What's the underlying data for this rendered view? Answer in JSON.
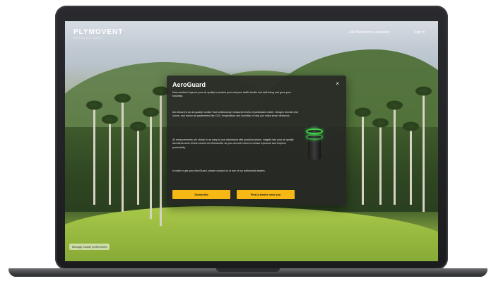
{
  "header": {
    "logo_text": "PLYMOVENT",
    "logo_tagline": "BREATHE EASY",
    "nav": {
      "contact_label": "Ask Plymovent a question",
      "signin_label": "Sign in"
    }
  },
  "modal": {
    "title": "AeroGuard",
    "close_label": "×",
    "paragraphs": [
      "New solution! Improve your air quality to protect your and your staff's health and well-being and grow your business.",
      "AeroGuard is an air-quality monitor that continuously measures levels of particulate matter, nitrogen dioxide and ozone, and indoor-air parameters like CO2, temperature and humidity, to help you make smart decisions.",
      "All measurements are shown in an easy-to-use dashboard with practical advice, insights into your air quality and alerts when levels exceed set thresholds, so you can act in time to reduce exposure and improve productivity.",
      "In order to get your AeroGuard, please contact us or one of our authorized dealers."
    ],
    "buttons": {
      "subscribe_label": "Subscribe",
      "dealer_label": "Find a dealer near you"
    }
  },
  "footer": {
    "preferences_label": "Manage cookie preferences"
  },
  "colors": {
    "accent": "#f5b814",
    "device_ring": "#41d14a",
    "modal_bg": "#262624"
  }
}
